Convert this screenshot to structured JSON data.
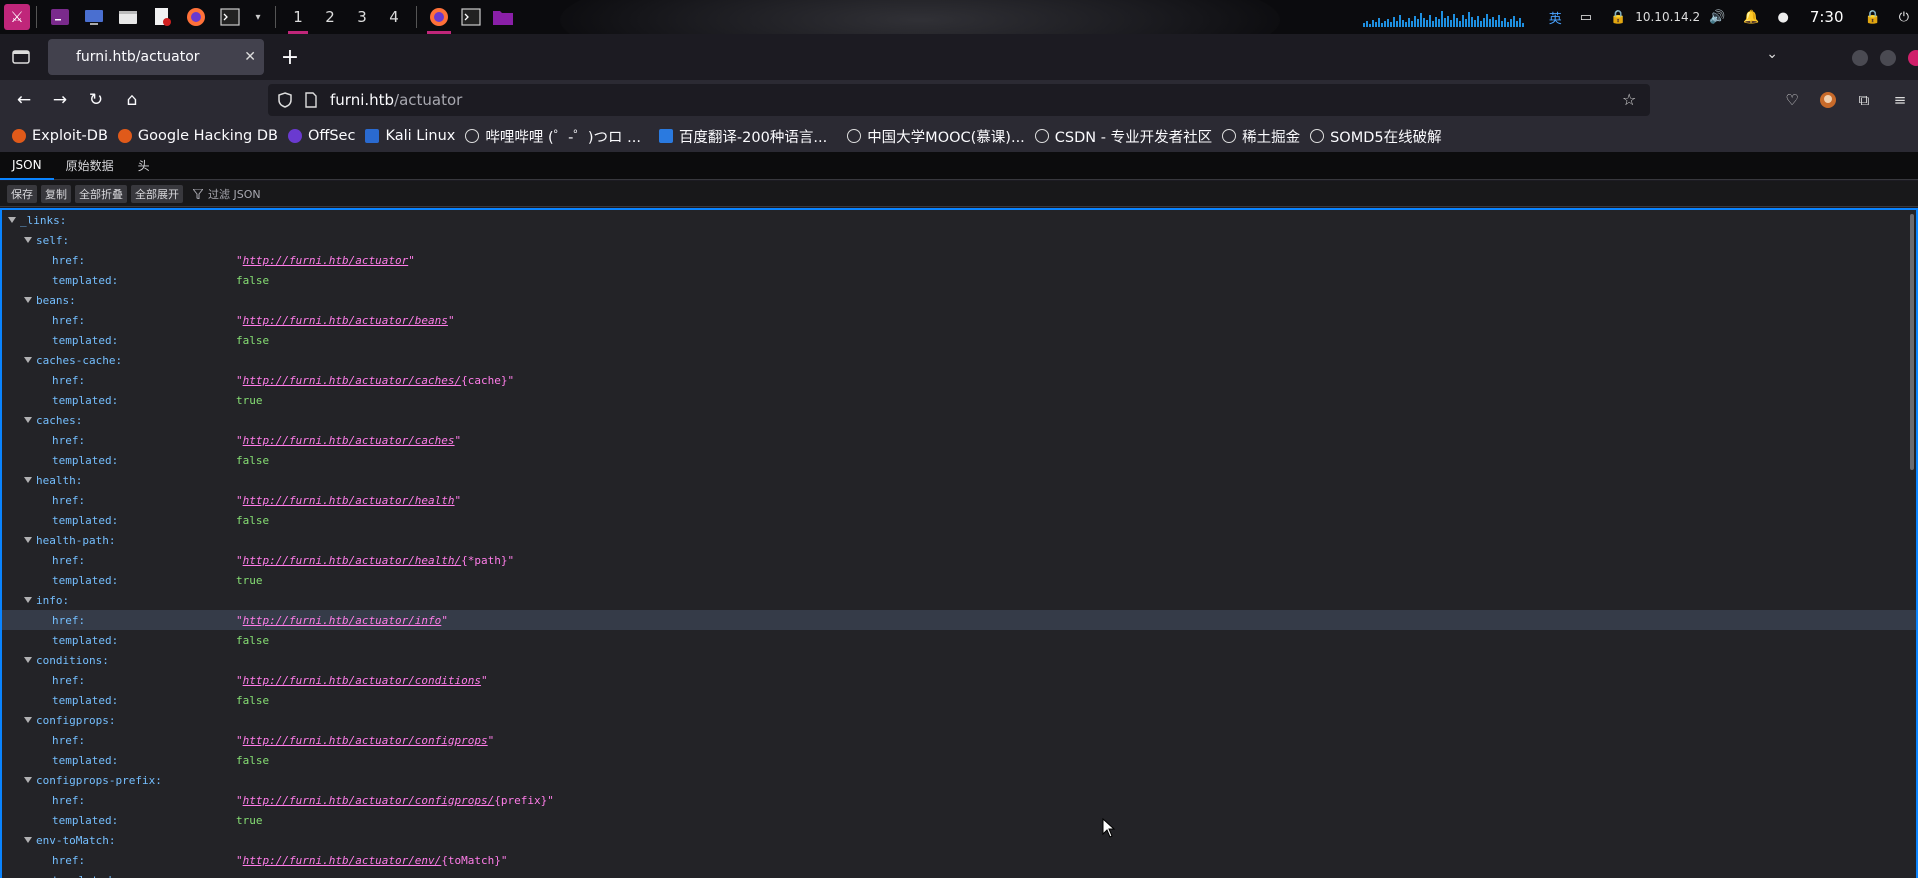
{
  "taskbar": {
    "workspaces": [
      "1",
      "2",
      "3",
      "4"
    ],
    "active_workspace": "1",
    "ime_label": "英",
    "ip_address": "10.10.14.2",
    "clock": "7:30",
    "accent_color": "#c0267a"
  },
  "browser": {
    "tab_title": "furni.htb/actuator",
    "url_host": "furni.htb",
    "url_path": "/actuator",
    "bookmarks": [
      {
        "label": "Exploit-DB",
        "icon": "exploitdb-icon"
      },
      {
        "label": "Google Hacking DB",
        "icon": "ghdb-icon"
      },
      {
        "label": "OffSec",
        "icon": "offsec-icon"
      },
      {
        "label": "Kali Linux",
        "icon": "kali-icon"
      },
      {
        "label": "哔哩哔哩 (゜-゜)つロ ...",
        "icon": "globe-icon"
      },
      {
        "label": "百度翻译-200种语言...",
        "icon": "baidu-translate-icon"
      },
      {
        "label": "中国大学MOOC(慕课)...",
        "icon": "globe-icon"
      },
      {
        "label": "CSDN - 专业开发者社区",
        "icon": "globe-icon"
      },
      {
        "label": "稀土掘金",
        "icon": "globe-icon"
      },
      {
        "label": "SOMD5在线破解",
        "icon": "globe-icon"
      }
    ]
  },
  "json_viewer": {
    "tabs": [
      "JSON",
      "原始数据",
      "头"
    ],
    "selected_tab": "JSON",
    "toolbar": {
      "save": "保存",
      "copy": "复制",
      "collapse_all": "全部折叠",
      "expand_all": "全部展开",
      "filter_placeholder": "过滤 JSON"
    },
    "root_key": "_links:",
    "entries": [
      {
        "name": "self:",
        "href_link": "http://furni.htb/actuator",
        "href_rest": "",
        "templated": "false"
      },
      {
        "name": "beans:",
        "href_link": "http://furni.htb/actuator/beans",
        "href_rest": "",
        "templated": "false"
      },
      {
        "name": "caches-cache:",
        "href_link": "http://furni.htb/actuator/caches/",
        "href_rest": "{cache}",
        "templated": "true"
      },
      {
        "name": "caches:",
        "href_link": "http://furni.htb/actuator/caches",
        "href_rest": "",
        "templated": "false"
      },
      {
        "name": "health:",
        "href_link": "http://furni.htb/actuator/health",
        "href_rest": "",
        "templated": "false"
      },
      {
        "name": "health-path:",
        "href_link": "http://furni.htb/actuator/health/",
        "href_rest": "{*path}",
        "templated": "true"
      },
      {
        "name": "info:",
        "href_link": "http://furni.htb/actuator/info",
        "href_rest": "",
        "templated": "false"
      },
      {
        "name": "conditions:",
        "href_link": "http://furni.htb/actuator/conditions",
        "href_rest": "",
        "templated": "false"
      },
      {
        "name": "configprops:",
        "href_link": "http://furni.htb/actuator/configprops",
        "href_rest": "",
        "templated": "false"
      },
      {
        "name": "configprops-prefix:",
        "href_link": "http://furni.htb/actuator/configprops/",
        "href_rest": "{prefix}",
        "templated": "true"
      },
      {
        "name": "env-toMatch:",
        "href_link": "http://furni.htb/actuator/env/",
        "href_rest": "{toMatch}",
        "templated": ""
      }
    ],
    "href_key": "href:",
    "templated_key": "templated:",
    "highlighted_entry_index": 6
  }
}
